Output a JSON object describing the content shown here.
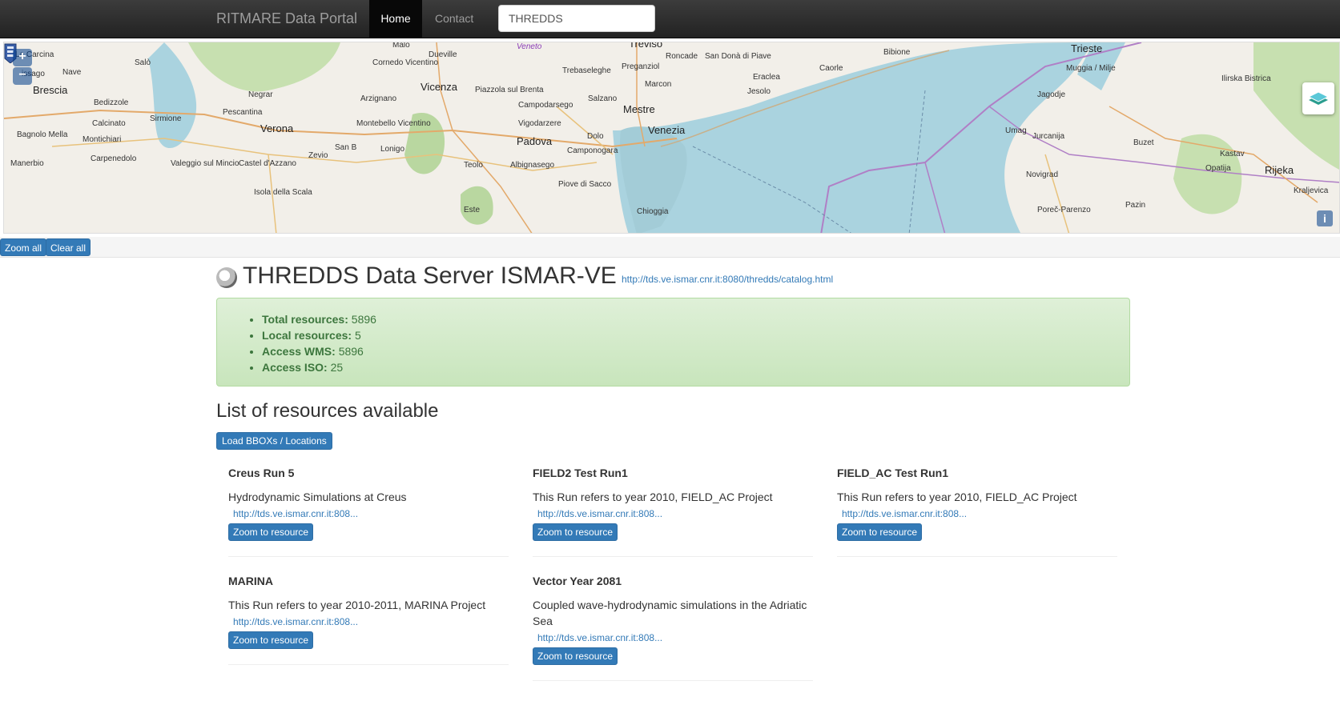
{
  "navbar": {
    "brand": "RITMARE Data Portal",
    "home_label": "Home",
    "contact_label": "Contact",
    "search_value": "THREDDS"
  },
  "map": {
    "zoom_in": "+",
    "zoom_out": "−",
    "info": "i",
    "labels": {
      "la_carcina": "La Carcina",
      "malo": "Malo",
      "dueville": "Dueville",
      "veneto": "Veneto",
      "treviso": "Treviso",
      "roncade": "Roncade",
      "san_dona": "San Donà di Piave",
      "bibione": "Bibione",
      "trieste": "Trieste",
      "salo": "Salò",
      "nave": "Nave",
      "cornedo": "Cornedo Vicentino",
      "trebaseleghe": "Trebaseleghe",
      "preganziol": "Preganziol",
      "caorle": "Caorle",
      "muggia": "Muggia / Milje",
      "ilirska": "Ilirska Bistrica",
      "brescia": "Brescia",
      "vicenza": "Vicenza",
      "piazzola": "Piazzola sul Brenta",
      "marcon": "Marcon",
      "eraclea": "Eraclea",
      "jesolo": "Jesolo",
      "negrar": "Negrar",
      "arzignano": "Arzignano",
      "campodarsego": "Campodarsego",
      "salzano": "Salzano",
      "jagodje": "Jagodje",
      "bedizzole": "Bedizzole",
      "mestre": "Mestre",
      "sirmione": "Sirmione",
      "pescantina": "Pescantina",
      "calcinato": "Calcinato",
      "montebello": "Montebello Vicentino",
      "vigodarzere": "Vigodarzere",
      "venezia": "Venezia",
      "umag": "Umag",
      "verona": "Verona",
      "bagnolo": "Bagnolo Mella",
      "montichiari": "Montichiari",
      "dolo": "Dolo",
      "jurcanija": "Jurcanija",
      "buzet": "Buzet",
      "padova": "Padova",
      "san_b": "San B",
      "lonigo": "Lonigo",
      "camponogara": "Camponogara",
      "zevio": "Zevio",
      "kastav": "Kastav",
      "manerbio": "Manerbio",
      "carpenedolo": "Carpenedolo",
      "valeggio": "Valeggio sul Mincio",
      "castel": "Castel d'Azzano",
      "teolo": "Teolo",
      "albignasego": "Albignasego",
      "opatija": "Opatija",
      "rijeka": "Rijeka",
      "novigrad": "Novigrad",
      "isola": "Isola della Scala",
      "piove": "Piove di Sacco",
      "kraljevica": "Kraljevica",
      "pazin": "Pazin",
      "este": "Este",
      "chioggia": "Chioggia",
      "porec": "Poreč-Parenzo",
      "issago": "issago"
    }
  },
  "toolbar": {
    "zoom_all": "Zoom all",
    "clear_all": "Clear all"
  },
  "server": {
    "title": "THREDDS Data Server ISMAR-VE",
    "url": "http://tds.ve.ismar.cnr.it:8080/thredds/catalog.html"
  },
  "stats": {
    "total_label": "Total resources:",
    "total_value": "5896",
    "local_label": "Local resources:",
    "local_value": "5",
    "wms_label": "Access WMS:",
    "wms_value": "5896",
    "iso_label": "Access ISO:",
    "iso_value": "25"
  },
  "resources": {
    "heading": "List of resources available",
    "load_button": "Load BBOXs / Locations",
    "zoom_label": "Zoom to resource",
    "items": [
      {
        "title": "Creus Run 5",
        "desc": "Hydrodynamic Simulations at Creus",
        "link": "http://tds.ve.ismar.cnr.it:808..."
      },
      {
        "title": "FIELD2 Test Run1",
        "desc": "This Run refers to year 2010, FIELD_AC Project",
        "link": "http://tds.ve.ismar.cnr.it:808..."
      },
      {
        "title": "FIELD_AC Test Run1",
        "desc": "This Run refers to year 2010, FIELD_AC Project",
        "link": "http://tds.ve.ismar.cnr.it:808..."
      },
      {
        "title": "MARINA",
        "desc": "This Run refers to year 2010-2011, MARINA Project",
        "link": "http://tds.ve.ismar.cnr.it:808..."
      },
      {
        "title": "Vector Year 2081",
        "desc": "Coupled wave-hydrodynamic simulations in the Adriatic Sea",
        "link": "http://tds.ve.ismar.cnr.it:808..."
      }
    ]
  }
}
